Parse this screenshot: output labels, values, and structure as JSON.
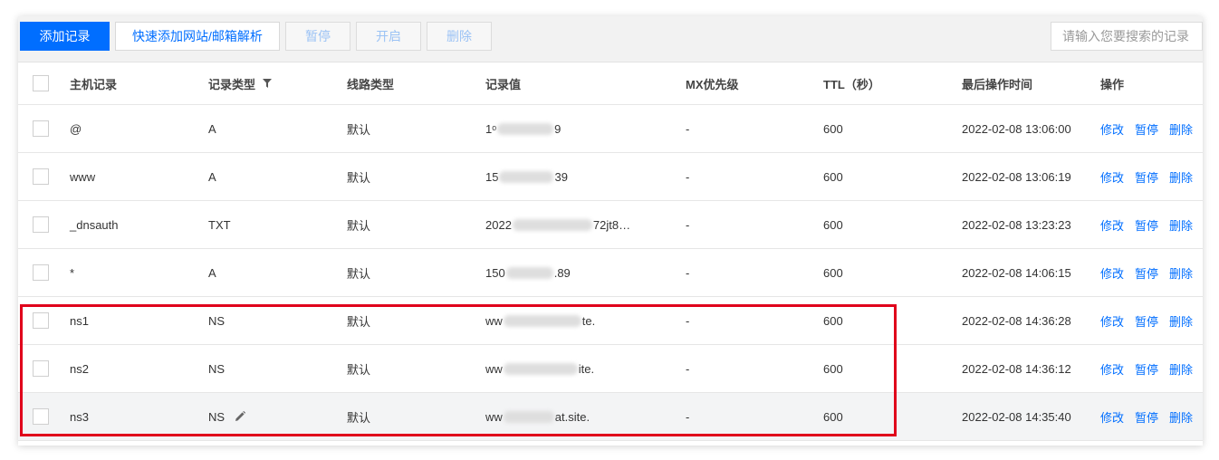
{
  "toolbar": {
    "add_record": "添加记录",
    "quick_add": "快速添加网站/邮箱解析",
    "pause": "暂停",
    "enable": "开启",
    "delete": "删除",
    "search_placeholder": "请输入您要搜索的记录"
  },
  "columns": {
    "host": "主机记录",
    "type": "记录类型",
    "line": "线路类型",
    "value": "记录值",
    "mx": "MX优先级",
    "ttl": "TTL（秒）",
    "updated": "最后操作时间",
    "actions": "操作"
  },
  "actions": {
    "edit": "修改",
    "pause": "暂停",
    "delete": "删除"
  },
  "rows": [
    {
      "host": "@",
      "type": "A",
      "line": "默认",
      "value_start": "1ᵒ",
      "value_end": "9",
      "mx": "-",
      "ttl": "600",
      "updated": "2022-02-08 13:06:00"
    },
    {
      "host": "www",
      "type": "A",
      "line": "默认",
      "value_start": "15",
      "value_end": "39",
      "mx": "-",
      "ttl": "600",
      "updated": "2022-02-08 13:06:19"
    },
    {
      "host": "_dnsauth",
      "type": "TXT",
      "line": "默认",
      "value_start": "2022",
      "value_end": "72jt8…",
      "mx": "-",
      "ttl": "600",
      "updated": "2022-02-08 13:23:23"
    },
    {
      "host": "*",
      "type": "A",
      "line": "默认",
      "value_start": "150",
      "value_end": ".89",
      "mx": "-",
      "ttl": "600",
      "updated": "2022-02-08 14:06:15"
    },
    {
      "host": "ns1",
      "type": "NS",
      "line": "默认",
      "value_start": "ww",
      "value_end": "te.",
      "mx": "-",
      "ttl": "600",
      "updated": "2022-02-08 14:36:28"
    },
    {
      "host": "ns2",
      "type": "NS",
      "line": "默认",
      "value_start": "ww",
      "value_end": "ite.",
      "mx": "-",
      "ttl": "600",
      "updated": "2022-02-08 14:36:12"
    },
    {
      "host": "ns3",
      "type": "NS",
      "line": "默认",
      "value_start": "ww",
      "value_end": "at.site.",
      "mx": "-",
      "ttl": "600",
      "updated": "2022-02-08 14:35:40"
    }
  ],
  "colors": {
    "accent": "#006eff",
    "highlight": "#e0001b"
  }
}
